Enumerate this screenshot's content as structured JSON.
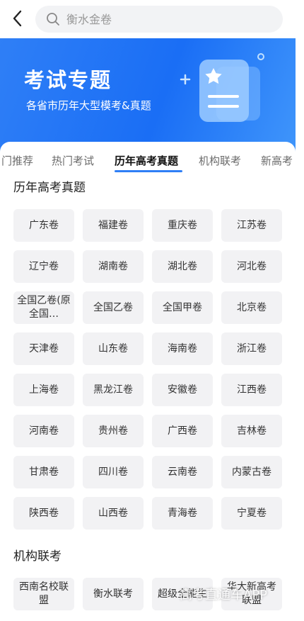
{
  "header": {
    "search_placeholder": "衡水金卷"
  },
  "banner": {
    "title": "考试专题",
    "subtitle": "各省市历年大型模考&真题"
  },
  "tabs": [
    {
      "label": "门推荐"
    },
    {
      "label": "热门考试"
    },
    {
      "label": "历年高考真题",
      "active": true
    },
    {
      "label": "机构联考"
    },
    {
      "label": "新高考"
    }
  ],
  "sections": {
    "past_exams": {
      "title": "历年高考真题",
      "items": [
        "广东卷",
        "福建卷",
        "重庆卷",
        "江苏卷",
        "辽宁卷",
        "湖南卷",
        "湖北卷",
        "河北卷",
        "全国乙卷(原全国…",
        "全国乙卷",
        "全国甲卷",
        "北京卷",
        "天津卷",
        "山东卷",
        "海南卷",
        "浙江卷",
        "上海卷",
        "黑龙江卷",
        "安徽卷",
        "江西卷",
        "河南卷",
        "贵州卷",
        "广西卷",
        "吉林卷",
        "甘肃卷",
        "四川卷",
        "云南卷",
        "内蒙古卷",
        "陕西卷",
        "山西卷",
        "青海卷",
        "宁夏卷"
      ]
    },
    "joint_exams": {
      "title": "机构联考",
      "items": [
        "西南名校联盟",
        "衡水联考",
        "超级全能生",
        "华大新高考联盟"
      ]
    }
  },
  "watermark": "高考直通车APP",
  "colors": {
    "accent": "#2f7ff6",
    "banner_start": "#2f7ff6",
    "chip_bg": "#f2f2f4"
  }
}
